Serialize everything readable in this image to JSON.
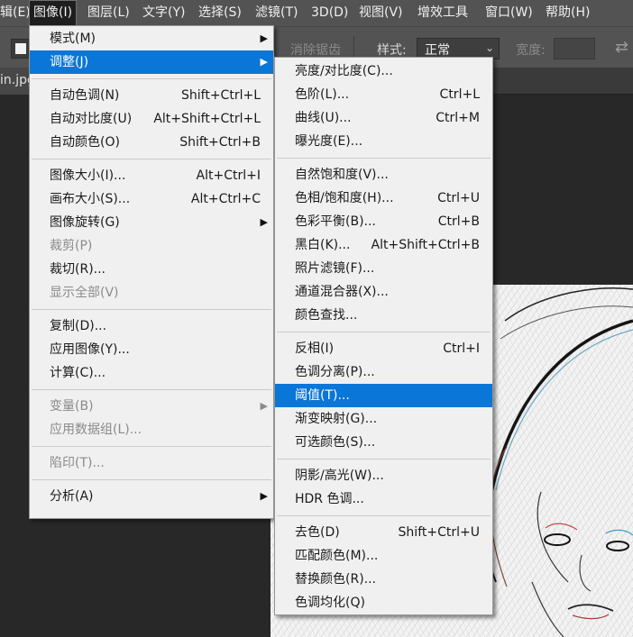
{
  "menubar": {
    "items": [
      "辑(E)",
      "图像(I)",
      "图层(L)",
      "文字(Y)",
      "选择(S)",
      "滤镜(T)",
      "3D(D)",
      "视图(V)",
      "增效工具",
      "窗口(W)",
      "帮助(H)"
    ]
  },
  "options": {
    "antialias": "消除锯齿",
    "style_label": "样式:",
    "style_value": "正常",
    "width_label": "宽度:"
  },
  "document_tab": "in.jpg",
  "image_menu": {
    "items": [
      {
        "label": "模式(M)",
        "submenu": true
      },
      {
        "label": "调整(J)",
        "submenu": true,
        "highlighted": true
      },
      {
        "sep": true
      },
      {
        "label": "自动色调(N)",
        "shortcut": "Shift+Ctrl+L"
      },
      {
        "label": "自动对比度(U)",
        "shortcut": "Alt+Shift+Ctrl+L"
      },
      {
        "label": "自动颜色(O)",
        "shortcut": "Shift+Ctrl+B"
      },
      {
        "sep": true
      },
      {
        "label": "图像大小(I)...",
        "shortcut": "Alt+Ctrl+I"
      },
      {
        "label": "画布大小(S)...",
        "shortcut": "Alt+Ctrl+C"
      },
      {
        "label": "图像旋转(G)",
        "submenu": true
      },
      {
        "label": "裁剪(P)",
        "disabled": true
      },
      {
        "label": "裁切(R)..."
      },
      {
        "label": "显示全部(V)",
        "disabled": true
      },
      {
        "sep": true
      },
      {
        "label": "复制(D)..."
      },
      {
        "label": "应用图像(Y)..."
      },
      {
        "label": "计算(C)..."
      },
      {
        "sep": true
      },
      {
        "label": "变量(B)",
        "submenu": true,
        "disabled": true
      },
      {
        "label": "应用数据组(L)...",
        "disabled": true
      },
      {
        "sep": true
      },
      {
        "label": "陷印(T)...",
        "disabled": true
      },
      {
        "sep": true
      },
      {
        "label": "分析(A)",
        "submenu": true
      }
    ]
  },
  "adjust_menu": {
    "items": [
      {
        "label": "亮度/对比度(C)..."
      },
      {
        "label": "色阶(L)...",
        "shortcut": "Ctrl+L"
      },
      {
        "label": "曲线(U)...",
        "shortcut": "Ctrl+M"
      },
      {
        "label": "曝光度(E)..."
      },
      {
        "sep": true
      },
      {
        "label": "自然饱和度(V)..."
      },
      {
        "label": "色相/饱和度(H)...",
        "shortcut": "Ctrl+U"
      },
      {
        "label": "色彩平衡(B)...",
        "shortcut": "Ctrl+B"
      },
      {
        "label": "黑白(K)...",
        "shortcut": "Alt+Shift+Ctrl+B"
      },
      {
        "label": "照片滤镜(F)..."
      },
      {
        "label": "通道混合器(X)..."
      },
      {
        "label": "颜色查找..."
      },
      {
        "sep": true
      },
      {
        "label": "反相(I)",
        "shortcut": "Ctrl+I"
      },
      {
        "label": "色调分离(P)..."
      },
      {
        "label": "阈值(T)...",
        "highlighted": true
      },
      {
        "label": "渐变映射(G)..."
      },
      {
        "label": "可选颜色(S)..."
      },
      {
        "sep": true
      },
      {
        "label": "阴影/高光(W)..."
      },
      {
        "label": "HDR 色调..."
      },
      {
        "sep": true
      },
      {
        "label": "去色(D)",
        "shortcut": "Shift+Ctrl+U"
      },
      {
        "label": "匹配颜色(M)..."
      },
      {
        "label": "替换颜色(R)..."
      },
      {
        "label": "色调均化(Q)"
      }
    ]
  }
}
